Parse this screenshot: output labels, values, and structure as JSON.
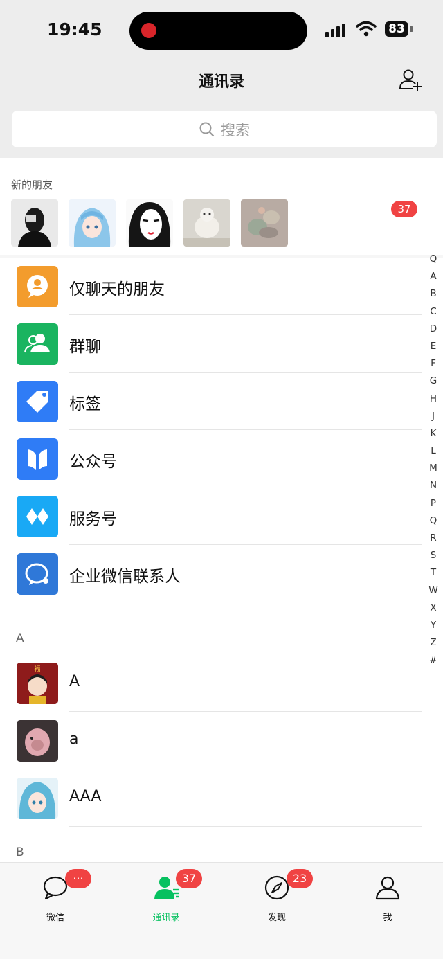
{
  "status_bar": {
    "time": "19:45",
    "battery": "83"
  },
  "header": {
    "title": "通讯录"
  },
  "search": {
    "placeholder": "搜索"
  },
  "new_friends": {
    "label": "新的朋友",
    "badge": "37"
  },
  "features": [
    {
      "label": "仅聊天的朋友",
      "icon": "chat-only-friends-icon",
      "color": "#f39c2d"
    },
    {
      "label": "群聊",
      "icon": "group-chat-icon",
      "color": "#1ab460"
    },
    {
      "label": "标签",
      "icon": "tag-icon",
      "color": "#2f7cf6"
    },
    {
      "label": "公众号",
      "icon": "official-account-icon",
      "color": "#2f7cf6"
    },
    {
      "label": "服务号",
      "icon": "service-account-icon",
      "color": "#19a9f5"
    },
    {
      "label": "企业微信联系人",
      "icon": "enterprise-wechat-icon",
      "color": "#2f78d8"
    }
  ],
  "sections": [
    {
      "letter": "A",
      "contacts": [
        {
          "name": "A"
        },
        {
          "name": "a"
        },
        {
          "name": "AAA"
        }
      ]
    },
    {
      "letter": "B",
      "contacts": []
    }
  ],
  "index_letters": [
    "Q",
    "A",
    "B",
    "C",
    "D",
    "E",
    "F",
    "G",
    "H",
    "J",
    "K",
    "L",
    "M",
    "N",
    "P",
    "Q",
    "R",
    "S",
    "T",
    "W",
    "X",
    "Y",
    "Z",
    "#"
  ],
  "tabs": [
    {
      "label": "微信",
      "badge": "···",
      "active": false
    },
    {
      "label": "通讯录",
      "badge": "37",
      "active": true
    },
    {
      "label": "发现",
      "badge": "23",
      "active": false
    },
    {
      "label": "我",
      "badge": "",
      "active": false
    }
  ],
  "colors": {
    "accent": "#07c160",
    "badge": "#f04343"
  }
}
